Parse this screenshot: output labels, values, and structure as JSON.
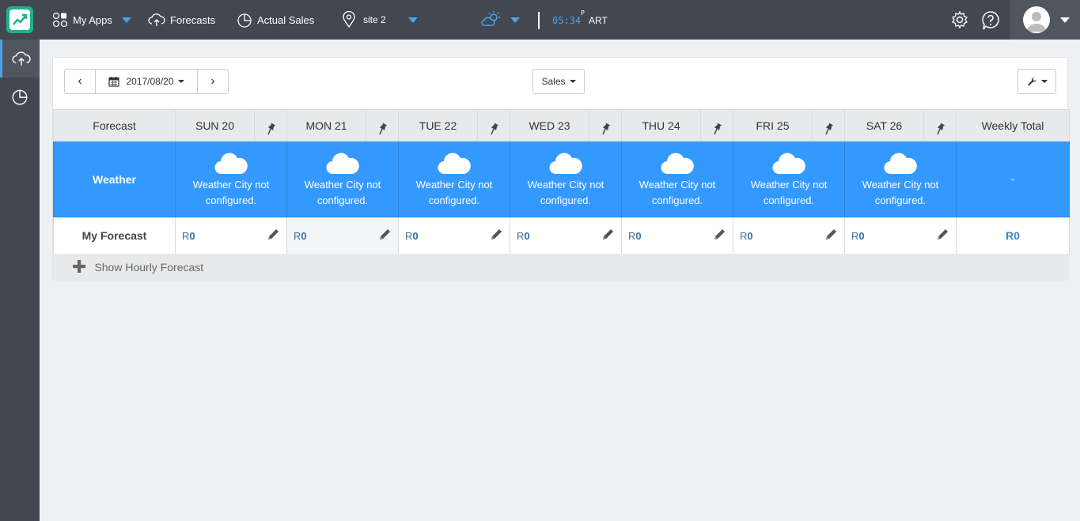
{
  "topbar": {
    "my_apps": "My Apps",
    "forecasts": "Forecasts",
    "actual_sales": "Actual Sales",
    "site": "site 2",
    "time_h": "05",
    "time_m": "34",
    "time_ampm": "P",
    "timezone": "ART"
  },
  "toolbar": {
    "prev": "‹",
    "next": "›",
    "date": "2017/08/20",
    "metric": "Sales"
  },
  "table": {
    "header_label": "Forecast",
    "days": [
      "SUN 20",
      "MON 21",
      "TUE 22",
      "WED 23",
      "THU 24",
      "FRI 25",
      "SAT 26"
    ],
    "weekly_total_header": "Weekly Total",
    "weather_label": "Weather",
    "weather_msg_1": "Weather City not",
    "weather_msg_2": "configured.",
    "weather_total": "-",
    "forecast_label": "My Forecast",
    "forecast_currency": "R",
    "forecast_values": [
      "0",
      "0",
      "0",
      "0",
      "0",
      "0",
      "0"
    ],
    "forecast_total": "R0"
  },
  "hourly_label": "Show Hourly Forecast",
  "colors": {
    "accent": "#3399ff",
    "topbar": "#424750",
    "brand": "#20b08a"
  }
}
